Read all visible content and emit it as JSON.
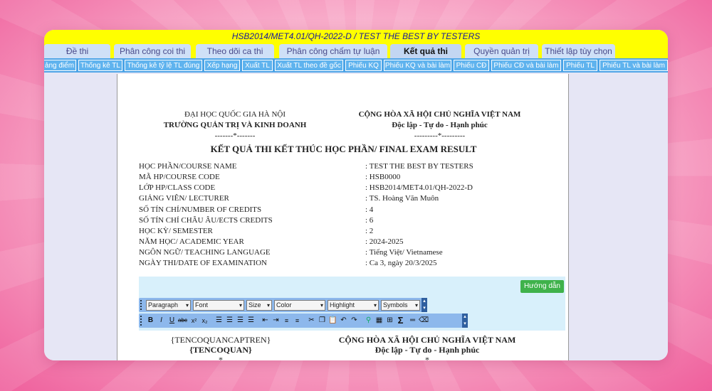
{
  "window": {
    "title": "HSB2014/MET4.01/QH-2022-D / TEST THE BEST BY TESTERS"
  },
  "tabs": [
    {
      "label": "Đề thi",
      "active": false
    },
    {
      "label": "Phân công coi thi",
      "active": false
    },
    {
      "label": "Theo dõi ca thi",
      "active": false
    },
    {
      "label": "Phân công chấm tự luận",
      "active": false
    },
    {
      "label": "Kết quả thi",
      "active": true
    },
    {
      "label": "Quyền quản trị",
      "active": false
    },
    {
      "label": "Thiết lập tùy chọn",
      "active": false
    }
  ],
  "subtabs": [
    "ảng điểm",
    "Thống kê TL",
    "Thống kê tỷ lệ TL đúng",
    "Xếp hạng",
    "Xuất TL",
    "Xuất TL theo đề gốc",
    "Phiếu KQ",
    "Phiếu KQ và bài làm",
    "Phiếu CĐ",
    "Phiếu CĐ và bài làm",
    "Phiếu TL",
    "Phiếu TL và bài làm"
  ],
  "document": {
    "left_header": {
      "line1": "ĐẠI HỌC QUỐC GIA HÀ NỘI",
      "line2": "TRƯỜNG QUẢN TRỊ VÀ KINH DOANH",
      "line3": "-------*-------"
    },
    "right_header": {
      "line1": "CỘNG HÒA XÃ HỘI CHỦ NGHĨA VIỆT NAM",
      "line2": "Độc lập - Tự do - Hạnh phúc",
      "line3": "---------*---------"
    },
    "title": "KẾT QUẢ THI KẾT THÚC HỌC PHẦN/ FINAL EXAM RESULT",
    "info": [
      {
        "label": "HỌC PHẦN/COURSE NAME",
        "value": ": TEST THE BEST BY TESTERS"
      },
      {
        "label": "MÃ HP/COURSE CODE",
        "value": ": HSB0000"
      },
      {
        "label": "LỚP HP/CLASS CODE",
        "value": ": HSB2014/MET4.01/QH-2022-D"
      },
      {
        "label": "GIẢNG VIÊN/ LECTURER",
        "value": ": TS. Hoàng Văn Muôn"
      },
      {
        "label": "SỐ TÍN CHỈ/NUMBER OF CREDITS",
        "value": ": 4"
      },
      {
        "label": "SỐ TÍN CHỈ CHÂU ÂU/ECTS CREDITS",
        "value": ": 6"
      },
      {
        "label": "HỌC KỲ/ SEMESTER",
        "value": ": 2"
      },
      {
        "label": "NĂM HỌC/ ACADEMIC YEAR",
        "value": ": 2024-2025"
      },
      {
        "label": "NGÔN NGỮ/ TEACHING LANGUAGE",
        "value": ": Tiếng Việt/ Vietnamese"
      },
      {
        "label": "NGÀY THI/DATE OF EXAMINATION",
        "value": ": Ca 3, ngày 20/3/2025"
      }
    ]
  },
  "editor": {
    "guide_button": "Hướng dẫn",
    "dropdowns": {
      "format": "Paragraph",
      "font": "Font",
      "size": "Size",
      "color": "Color",
      "highlight": "Highlight",
      "symbols": "Symbols"
    },
    "content": {
      "left_line1": "{TENCOQUANCAPTREN}",
      "left_line2": "{TENCOQUAN}",
      "left_line3": "*",
      "right_line1": "CỘNG HÒA XÃ HỘI CHỦ NGHĨA VIỆT NAM",
      "right_line2": "Độc lập - Tự do - Hạnh phúc",
      "right_line3": "*"
    }
  }
}
